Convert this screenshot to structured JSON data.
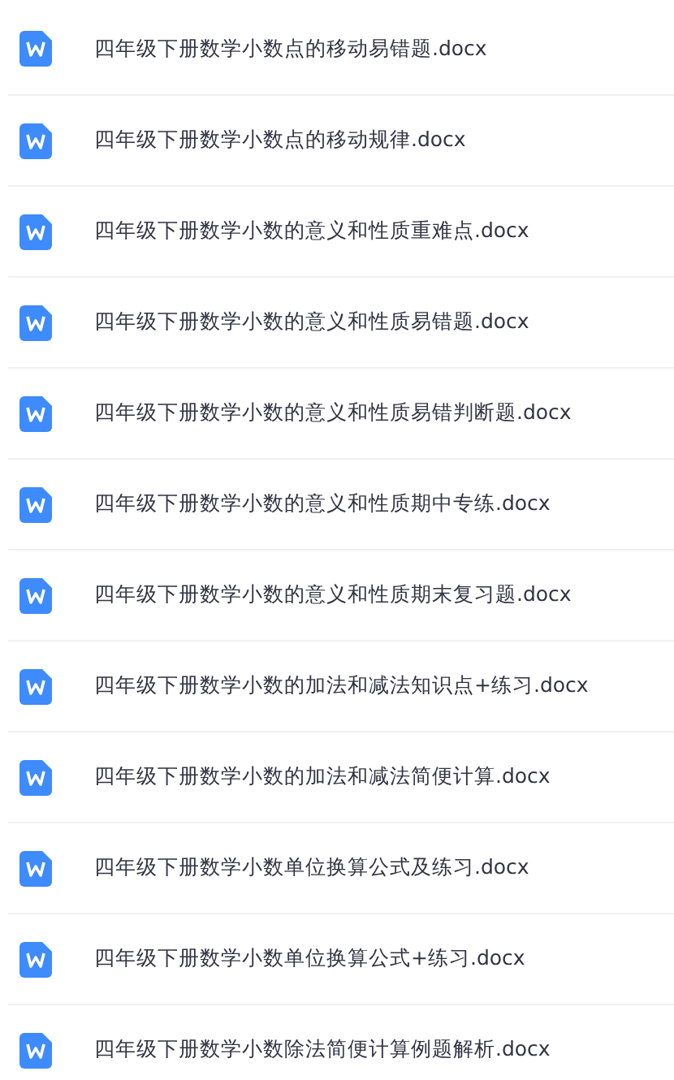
{
  "files": [
    {
      "name": "四年级下册数学小数点的移动易错题.docx"
    },
    {
      "name": "四年级下册数学小数点的移动规律.docx"
    },
    {
      "name": "四年级下册数学小数的意义和性质重难点.docx"
    },
    {
      "name": "四年级下册数学小数的意义和性质易错题.docx"
    },
    {
      "name": "四年级下册数学小数的意义和性质易错判断题.docx"
    },
    {
      "name": "四年级下册数学小数的意义和性质期中专练.docx"
    },
    {
      "name": "四年级下册数学小数的意义和性质期末复习题.docx"
    },
    {
      "name": "四年级下册数学小数的加法和减法知识点+练习.docx"
    },
    {
      "name": "四年级下册数学小数的加法和减法简便计算.docx"
    },
    {
      "name": "四年级下册数学小数单位换算公式及练习.docx"
    },
    {
      "name": "四年级下册数学小数单位换算公式+练习.docx"
    },
    {
      "name": "四年级下册数学小数除法简便计算例题解析.docx"
    }
  ]
}
